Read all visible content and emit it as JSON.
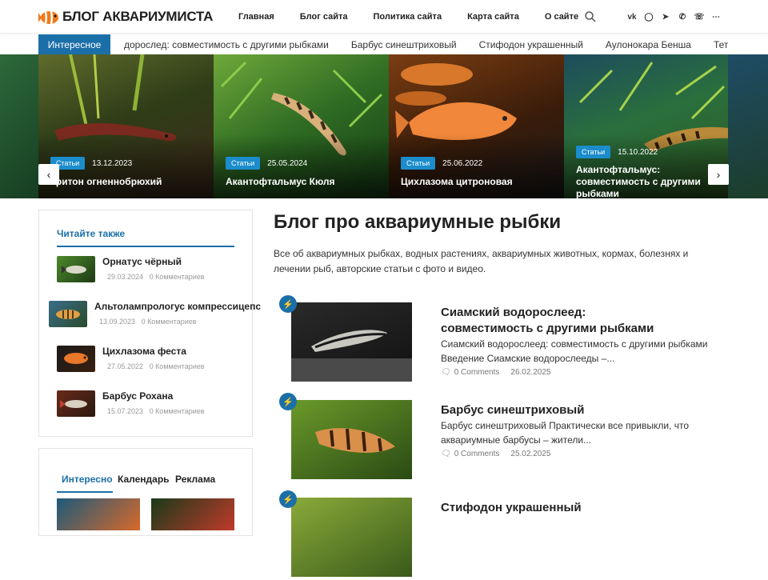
{
  "header": {
    "logo_text": "БЛОГ АКВАРИУМИСТА",
    "nav": [
      "Главная",
      "Блог сайта",
      "Политика сайта",
      "Карта сайта",
      "О сайте"
    ],
    "socials": [
      "vk-icon",
      "ok-icon",
      "telegram-icon",
      "viber-icon",
      "whatsapp-icon",
      "more-icon"
    ]
  },
  "ticker": {
    "label": "Интересное",
    "items": [
      "дорослед: совместимость с другими рыбками",
      "Барбус синештриховый",
      "Стифодон украшенный",
      "Аулонокара Бенша",
      "Тетра: у:"
    ]
  },
  "slider": [
    {
      "tag": "Статьи",
      "date": "13.12.2023",
      "title": "Тритон огненнобрюхий"
    },
    {
      "tag": "Статьи",
      "date": "25.05.2024",
      "title": "Акантофтальмус Кюля"
    },
    {
      "tag": "Статьи",
      "date": "25.06.2022",
      "title": "Цихлазома цитроновая"
    },
    {
      "tag": "Статьи",
      "date": "15.10.2022",
      "title": "Акантофтальмус: совместимость с другими рыбками"
    }
  ],
  "sidebar": {
    "title": "Читайте также",
    "items": [
      {
        "name": "Орнатус чёрный",
        "date": "29.03.2024",
        "comments": "0 Комментариев"
      },
      {
        "name": "Альтолампрологус компрессицепс",
        "date": "13.09.2023",
        "comments": "0 Комментариев"
      },
      {
        "name": "Цихлазома феста",
        "date": "27.05.2022",
        "comments": "0 Комментариев"
      },
      {
        "name": "Барбус Рохана",
        "date": "15.07.2023",
        "comments": "0 Комментариев"
      }
    ]
  },
  "tabs": [
    "Интересно",
    "Календарь",
    "Реклама"
  ],
  "main": {
    "title": "Блог про аквариумные рыбки",
    "description": "Все об аквариумных рыбках, водных растениях, аквариумных животных, кормах, болезнях и лечении рыб, авторские статьи с фото и видео.",
    "posts": [
      {
        "title": "Сиамский водорослеед: совместимость с другими рыбками",
        "excerpt": "Сиамский водорослеед: совместимость с другими рыбками Введение Сиамские водорослееды –...",
        "comments": "0 Comments",
        "date": "26.02.2025"
      },
      {
        "title": "Барбус синештриховый",
        "excerpt": "Барбус синештриховый Практически все привыкли, что аквариумные барбусы – жители...",
        "comments": "0 Comments",
        "date": "25.02.2025"
      },
      {
        "title": "Стифодон украшенный",
        "excerpt": "",
        "comments": "",
        "date": ""
      }
    ]
  },
  "colors": {
    "accent": "#1b6fa8",
    "tag": "#1b8ccc"
  }
}
